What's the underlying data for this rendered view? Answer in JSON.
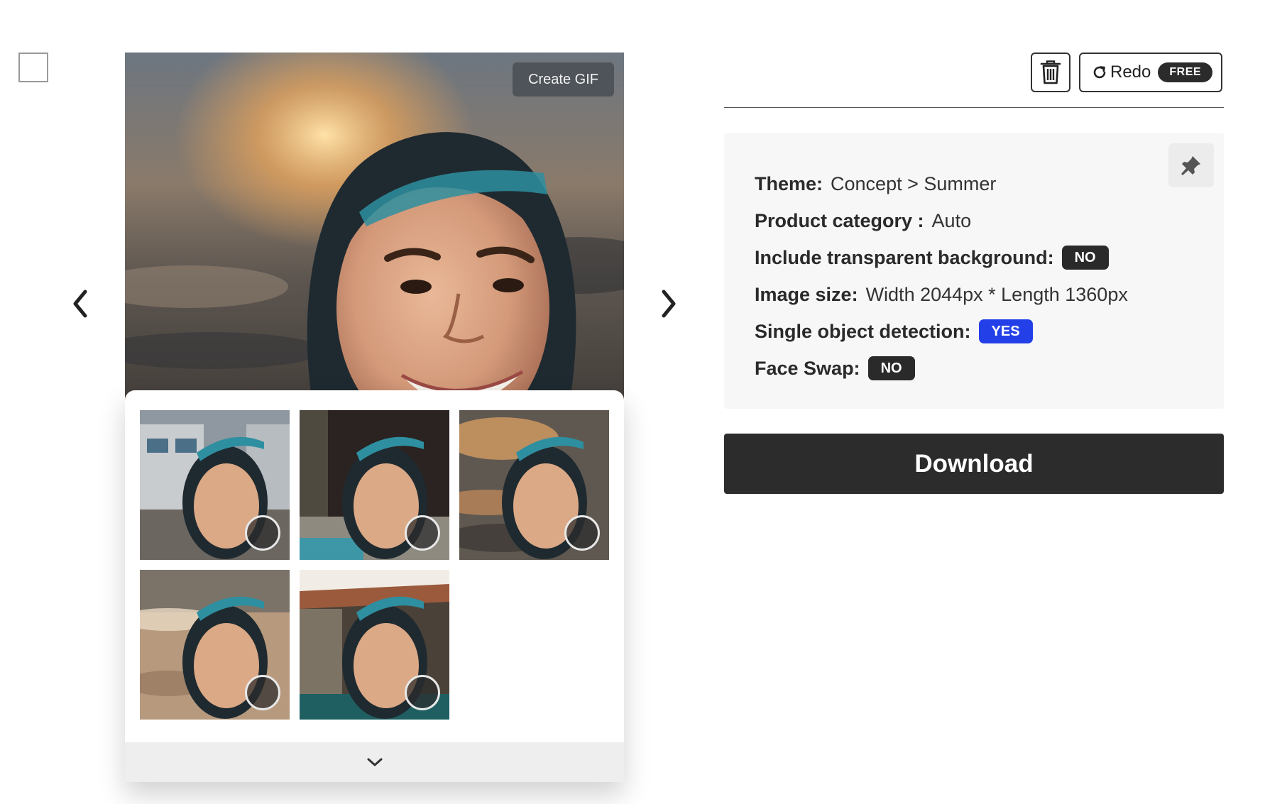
{
  "viewer": {
    "create_gif_label": "Create GIF",
    "thumbnails": [
      {
        "scene": "building-courtyard"
      },
      {
        "scene": "dark-pool-terrace"
      },
      {
        "scene": "ocean-waves-sunset"
      },
      {
        "scene": "sandy-beach-shore"
      },
      {
        "scene": "rock-pool-villa"
      }
    ]
  },
  "toolbar": {
    "redo_label": "Redo",
    "free_badge": "FREE"
  },
  "info": {
    "theme_label": "Theme:",
    "theme_value": "Concept > Summer",
    "category_label": "Product category :",
    "category_value": "Auto",
    "transparent_label": "Include transparent background:",
    "transparent_value": "NO",
    "size_label": "Image size:",
    "size_value": "Width 2044px * Length 1360px",
    "single_object_label": "Single object detection:",
    "single_object_value": "YES",
    "face_swap_label": "Face Swap:",
    "face_swap_value": "NO"
  },
  "download_label": "Download",
  "colors": {
    "primary_dark": "#2c2c2c",
    "accent_blue": "#2340e8",
    "card_background": "#f7f7f7"
  },
  "icons": {
    "select": "checkbox-icon",
    "previous": "chevron-left-icon",
    "next": "chevron-right-icon",
    "expand": "chevron-down-icon",
    "delete": "trash-icon",
    "redo": "redo-icon",
    "pin": "pin-icon"
  }
}
